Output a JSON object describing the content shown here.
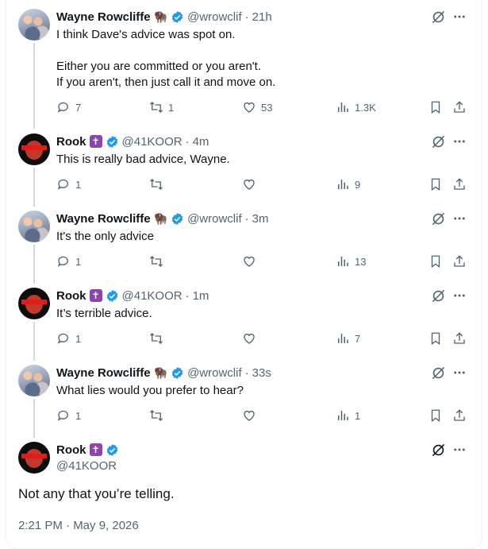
{
  "tweets": [
    {
      "name": "Wayne Rowcliffe",
      "emoji": "🦬",
      "handle": "@wrowclif",
      "time": "21h",
      "text": "I think Dave's advice was spot on.\n\nEither you are committed or you aren't.\nIf you aren't, then just call it and move on.",
      "replies": "7",
      "reposts": "1",
      "likes": "53",
      "views": "1.3K"
    },
    {
      "name": "Rook",
      "emoji": "✝",
      "handle": "@41KOOR",
      "time": "4m",
      "text": "This is really bad advice, Wayne.",
      "replies": "1",
      "reposts": "",
      "likes": "",
      "views": "9"
    },
    {
      "name": "Wayne Rowcliffe",
      "emoji": "🦬",
      "handle": "@wrowclif",
      "time": "3m",
      "text": "It's the only advice",
      "replies": "1",
      "reposts": "",
      "likes": "",
      "views": "13"
    },
    {
      "name": "Rook",
      "emoji": "✝",
      "handle": "@41KOOR",
      "time": "1m",
      "text": "It’s terrible advice.",
      "replies": "1",
      "reposts": "",
      "likes": "",
      "views": "7"
    },
    {
      "name": "Wayne Rowcliffe",
      "emoji": "🦬",
      "handle": "@wrowclif",
      "time": "33s",
      "text": "What lies would you prefer to hear?",
      "replies": "1",
      "reposts": "",
      "likes": "",
      "views": "1"
    }
  ],
  "main": {
    "name": "Rook",
    "emoji": "✝",
    "handle": "@41KOOR",
    "text": "Not any that you’re telling.",
    "timestamp": "2:21 PM · May 9, 2026"
  },
  "colors": {
    "text": "#0f1419",
    "muted": "#536471",
    "verified": "#1d9bf0",
    "thread_line": "#cfd9de"
  },
  "icons": [
    "reply-icon",
    "repost-icon",
    "like-icon",
    "views-icon",
    "bookmark-icon",
    "share-icon",
    "grok-icon",
    "more-icon",
    "verified-badge-icon"
  ]
}
